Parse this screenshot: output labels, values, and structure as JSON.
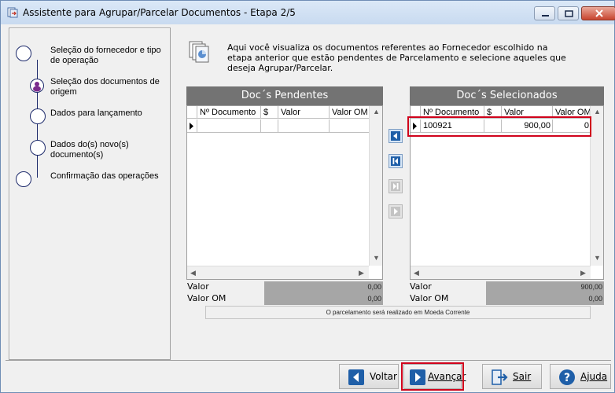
{
  "window": {
    "title": "Assistente para Agrupar/Parcelar Documentos - Etapa 2/5"
  },
  "steps": [
    {
      "label": "Seleção do fornecedor e tipo de operação",
      "active": false
    },
    {
      "label": "Seleção dos documentos de origem",
      "active": true
    },
    {
      "label": "Dados para lançamento",
      "active": false
    },
    {
      "label": "Dados do(s) novo(s) documento(s)",
      "active": false
    },
    {
      "label": "Confirmação das operações",
      "active": false
    }
  ],
  "info_text": "Aqui você visualiza os documentos referentes ao Fornecedor escolhido na etapa anterior que estão pendentes de Parcelamento e selecione aqueles que deseja Agrupar/Parcelar.",
  "pendentes": {
    "title": "Doc´s Pendentes",
    "columns": [
      "Nº Documento",
      "$",
      "Valor",
      "Valor OM"
    ],
    "rows": [],
    "totals": {
      "valor_label": "Valor",
      "valor": "0,00",
      "valor_om_label": "Valor OM",
      "valor_om": "0,00"
    }
  },
  "selecionados": {
    "title": "Doc´s Selecionados",
    "columns": [
      "Nº Documento",
      "$",
      "Valor",
      "Valor OM"
    ],
    "rows": [
      {
        "documento": "100921",
        "moeda": "",
        "valor": "900,00",
        "valor_om": "0"
      }
    ],
    "totals": {
      "valor_label": "Valor",
      "valor": "900,00",
      "valor_om_label": "Valor OM",
      "valor_om": "0,00"
    }
  },
  "status_message": "O parcelamento será realizado em Moeda Corrente",
  "buttons": {
    "voltar": "Voltar",
    "avancar": "Avançar",
    "sair": "Sair",
    "ajuda": "Ajuda"
  },
  "colors": {
    "highlight": "#d0021b",
    "grid_header": "#737373",
    "accent": "#1f5fa8"
  }
}
